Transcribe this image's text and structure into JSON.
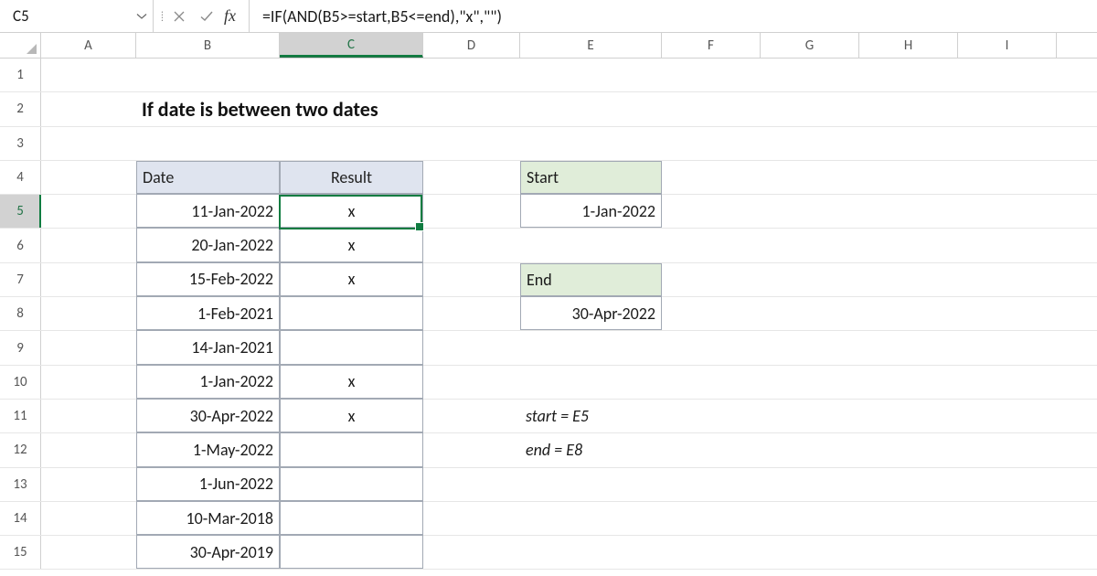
{
  "formula_bar": {
    "name_box": "C5",
    "formula": "=IF(AND(B5>=start,B5<=end),\"x\",\"\")"
  },
  "columns": {
    "A": "A",
    "B": "B",
    "C": "C",
    "D": "D",
    "E": "E",
    "F": "F",
    "G": "G",
    "H": "H",
    "I": "I"
  },
  "active": {
    "col": "C",
    "row": 5
  },
  "row_labels": [
    "1",
    "2",
    "3",
    "4",
    "5",
    "6",
    "7",
    "8",
    "9",
    "10",
    "11",
    "12",
    "13",
    "14",
    "15"
  ],
  "title": "If date is between two dates",
  "table": {
    "headers": {
      "date": "Date",
      "result": "Result"
    },
    "rows": [
      {
        "date": "11-Jan-2022",
        "result": "x"
      },
      {
        "date": "20-Jan-2022",
        "result": "x"
      },
      {
        "date": "15-Feb-2022",
        "result": "x"
      },
      {
        "date": "1-Feb-2021",
        "result": ""
      },
      {
        "date": "14-Jan-2021",
        "result": ""
      },
      {
        "date": "1-Jan-2022",
        "result": "x"
      },
      {
        "date": "30-Apr-2022",
        "result": "x"
      },
      {
        "date": "1-May-2022",
        "result": ""
      },
      {
        "date": "1-Jun-2022",
        "result": ""
      },
      {
        "date": "10-Mar-2018",
        "result": ""
      },
      {
        "date": "30-Apr-2019",
        "result": ""
      }
    ]
  },
  "range": {
    "start_label": "Start",
    "start_value": "1-Jan-2022",
    "end_label": "End",
    "end_value": "30-Apr-2022"
  },
  "notes": {
    "start": "start = E5",
    "end": "end = E8"
  }
}
